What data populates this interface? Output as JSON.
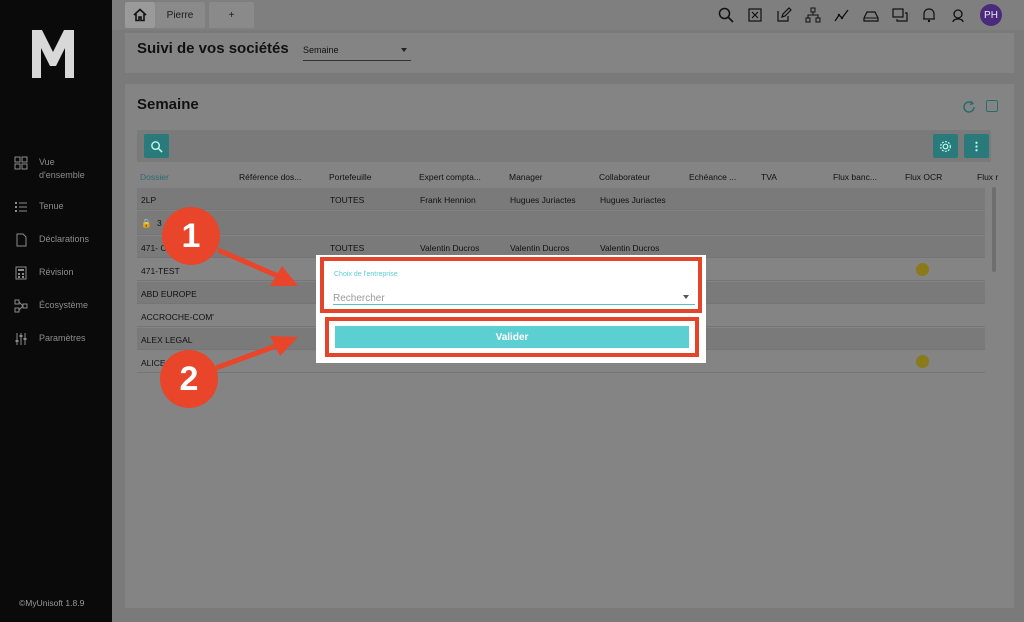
{
  "sidebar": {
    "items": [
      {
        "label": "Vue\nd'ensemble",
        "icon": "dashboard-icon"
      },
      {
        "label": "Tenue",
        "icon": "list-icon"
      },
      {
        "label": "Déclarations",
        "icon": "document-icon"
      },
      {
        "label": "Révision",
        "icon": "calculator-icon"
      },
      {
        "label": "Écosystème",
        "icon": "network-icon"
      },
      {
        "label": "Paramètres",
        "icon": "sliders-icon"
      }
    ],
    "footer": "©MyUnisoft 1.8.9"
  },
  "tabs": {
    "home_icon": "home-icon",
    "pierre": "Pierre",
    "add": "+"
  },
  "top_icons": [
    "search-icon",
    "excel-icon",
    "edit-icon",
    "org-chart-icon",
    "chart-icon",
    "tray-icon",
    "chat-icon",
    "bell-icon",
    "support-icon"
  ],
  "avatar": "PH",
  "header": {
    "title": "Suivi de vos sociétés",
    "period": "Semaine"
  },
  "main": {
    "title": "Semaine",
    "columns": [
      "Dossier",
      "Référence dos...",
      "Portefeuille",
      "Expert compta...",
      "Manager",
      "Collaborateur",
      "Echéance ...",
      "TVA",
      "Flux banc...",
      "Flux OCR",
      "Flux r"
    ],
    "rows": [
      {
        "dossier": "2LP",
        "portefeuille": "TOUTES",
        "expert": "Frank Hennion",
        "manager": "Hugues Juriactes",
        "collaborateur": "Hugues Juriactes"
      },
      {
        "dossier": "3"
      },
      {
        "dossier": "471- C",
        "portefeuille": "TOUTES",
        "expert": "Valentin Ducros",
        "manager": "Valentin Ducros",
        "collaborateur": "Valentin Ducros"
      },
      {
        "dossier": "471-TEST"
      },
      {
        "dossier": "ABD EUROPE"
      },
      {
        "dossier": "ACCROCHE-COM'"
      },
      {
        "dossier": "ALEX LEGAL"
      },
      {
        "dossier": "ALICE"
      }
    ]
  },
  "dialog": {
    "field_label": "Choix de l'entreprise",
    "placeholder": "Rechercher",
    "submit": "Valider"
  },
  "annotations": {
    "step1": "1",
    "step2": "2"
  },
  "colors": {
    "accent": "#5ccfd2",
    "annotation": "#e8452a",
    "avatar": "#4a2a7a"
  }
}
